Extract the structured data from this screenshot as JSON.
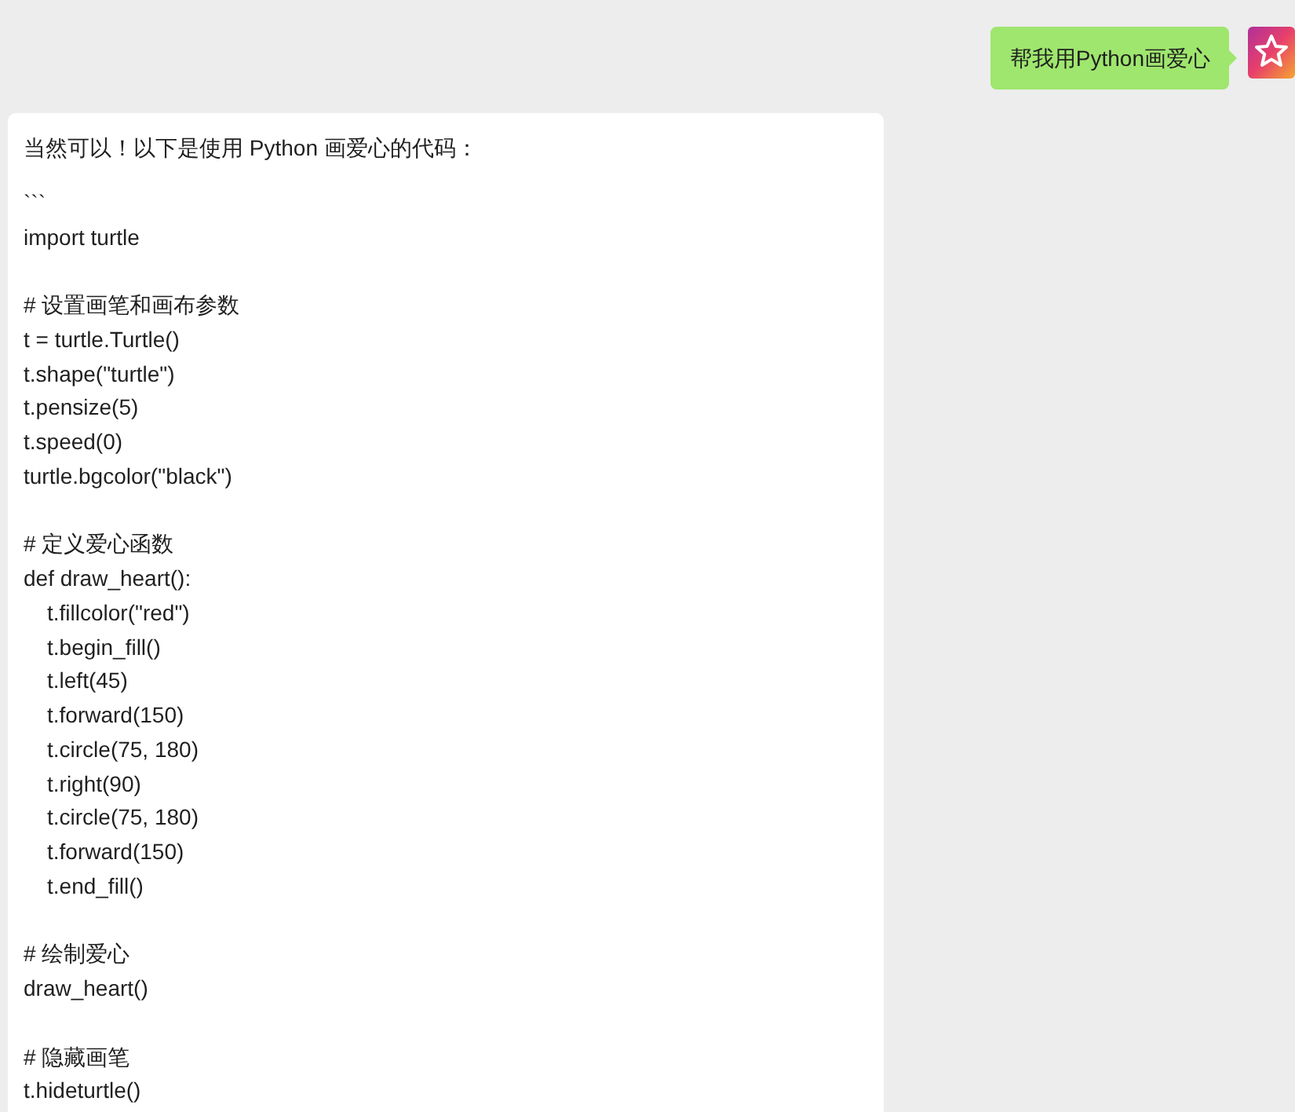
{
  "user_message": {
    "text": "帮我用Python画爱心"
  },
  "reply": {
    "intro": "当然可以！以下是使用 Python 画爱心的代码：",
    "blocks": [
      {
        "lines": [
          {
            "text": "```"
          },
          {
            "text": "import turtle"
          }
        ]
      },
      {
        "lines": [
          {
            "text": "# 设置画笔和画布参数"
          },
          {
            "text": "t = turtle.Turtle()"
          },
          {
            "text": "t.shape(\"turtle\")"
          },
          {
            "text": "t.pensize(5)"
          },
          {
            "text": "t.speed(0)"
          },
          {
            "text": "turtle.bgcolor(\"black\")"
          }
        ]
      },
      {
        "lines": [
          {
            "text": "# 定义爱心函数"
          },
          {
            "text": "def draw_heart():",
            "children": [
              {
                "text": "t.fillcolor(\"red\")"
              },
              {
                "text": "t.begin_fill()"
              },
              {
                "text": "t.left(45)"
              },
              {
                "text": "t.forward(150)"
              },
              {
                "text": "t.circle(75, 180)"
              },
              {
                "text": "t.right(90)"
              },
              {
                "text": "t.circle(75, 180)"
              },
              {
                "text": "t.forward(150)"
              },
              {
                "text": "t.end_fill()"
              }
            ]
          }
        ]
      },
      {
        "lines": [
          {
            "text": "# 绘制爱心"
          },
          {
            "text": "draw_heart()"
          }
        ]
      },
      {
        "lines": [
          {
            "text": "# 隐藏画笔"
          },
          {
            "text": "t.hideturtle()"
          }
        ]
      }
    ]
  }
}
